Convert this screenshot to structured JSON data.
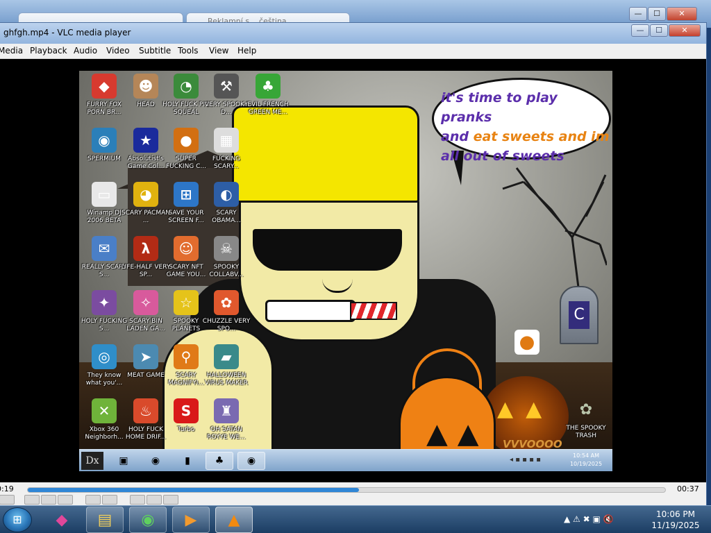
{
  "background_window": {
    "tab1_title": "",
    "tab2_title": "Reklamní s... čeština",
    "caption_min": "—",
    "caption_max": "☐",
    "caption_close": "✕"
  },
  "vlc": {
    "title": "ghfgh.mp4 - VLC media player",
    "window_buttons": {
      "minimize": "—",
      "maximize": "☐",
      "close": "✕"
    },
    "menu": [
      "Media",
      "Playback",
      "Audio",
      "Video",
      "Subtitle",
      "Tools",
      "View",
      "Help"
    ],
    "time_elapsed": "0:19",
    "time_total": "00:37",
    "progress_fraction": 0.52
  },
  "video_frame": {
    "speech_line1": "it's time to play pranks",
    "speech_line2a": "and ",
    "speech_line2b": "eat sweets and im",
    "speech_line3": "all out of sweets",
    "watermark": "VVVOOOO",
    "desktop_icons": [
      {
        "label": "FURRY FOX PORN BR...",
        "icon": "fox-icon",
        "color": "#d73a2f"
      },
      {
        "label": "HEAD",
        "icon": "head-icon",
        "color": "#b58658"
      },
      {
        "label": "HOLY FUCK PIG SQUEAL",
        "icon": "pie-chart-icon",
        "color": "#3b8b3b"
      },
      {
        "label": "VERY SPOOKY D...",
        "icon": "hammer-icon",
        "color": "#555555"
      },
      {
        "label": "EVIL FRENCH GREEN ME...",
        "icon": "messenger-icon",
        "color": "#37a637"
      },
      {
        "label": "SPERMIUM",
        "icon": "browser-icon",
        "color": "#2b7fb9"
      },
      {
        "label": "Absolutist's Game Col...",
        "icon": "star-icon",
        "color": "#1a2a9c"
      },
      {
        "label": "SUPER FUCKING C...",
        "icon": "pumpkin-icon",
        "color": "#d26f12"
      },
      {
        "label": "FUCKING SCARY...",
        "icon": "grid-icon",
        "color": "#dddddd"
      },
      {
        "label": "Winamp DJ 2006 BETA",
        "icon": "window-icon",
        "color": "#e8e8e8"
      },
      {
        "label": "SCARY PACMAN ...",
        "icon": "pacman-icon",
        "color": "#e0b20f"
      },
      {
        "label": "SAVE YOUR SCREEN F...",
        "icon": "windows-logo-icon",
        "color": "#2d76c7"
      },
      {
        "label": "SCARY OBAMA...",
        "icon": "obama-logo-icon",
        "color": "#2d5ea6"
      },
      {
        "label": "REALLY SCARY S...",
        "icon": "xat-icon",
        "color": "#4a7fc7"
      },
      {
        "label": "LIFE-HALF VERY SP...",
        "icon": "half-life-icon",
        "color": "#b22b15"
      },
      {
        "label": "SCARY NFT GAME YOU...",
        "icon": "monkey-icon",
        "color": "#e26c2e"
      },
      {
        "label": "SPOOKY COLLABV...",
        "icon": "skull-icon",
        "color": "#888888"
      },
      {
        "label": "HOLY FUCKING S...",
        "icon": "gift-icon",
        "color": "#7b4ca0"
      },
      {
        "label": "SCARY BIN LADEN GA...",
        "icon": "sparkle-icon",
        "color": "#d85a9c"
      },
      {
        "label": "SPOOKY PLANETS",
        "icon": "star-card-icon",
        "color": "#e5c31a"
      },
      {
        "label": "CHUZZLE VERY SPO...",
        "icon": "chuzzle-icon",
        "color": "#e0582d"
      },
      {
        "label": "They know what you'...",
        "icon": "eyes-icon",
        "color": "#2f8ec9"
      },
      {
        "label": "MEAT GAME",
        "icon": "fish-icon",
        "color": "#4c8ab1"
      },
      {
        "label": "SCARY MAGNIFYI...",
        "icon": "magnifier-icon",
        "color": "#e07a18"
      },
      {
        "label": "HALLOWEEN VIRUS MAKER",
        "icon": "tank-icon",
        "color": "#3a8a8a"
      },
      {
        "label": "Xbox 360 Neighborh...",
        "icon": "xbox-icon",
        "color": "#6fb33a"
      },
      {
        "label": "HOLY FUCK HOME DRIF...",
        "icon": "java-icon",
        "color": "#d94a2b"
      },
      {
        "label": "Turbo",
        "icon": "s-logo-icon",
        "color": "#d91919"
      },
      {
        "label": "OH SATAN ROYYE WE...",
        "icon": "robot-icon",
        "color": "#7a6ab1"
      }
    ],
    "right_pumpkin_icon": "pumpkin-icon",
    "tombstone_letter": "C",
    "trash_label": "THE SPOOKY TRASH",
    "inner_clock_time": "10:54 AM",
    "inner_clock_date": "10/19/2025",
    "inner_start": "Dx"
  },
  "outer_taskbar": {
    "start_icon": "windows-orb-icon",
    "tray_icons": "▲  ⚠  ✖  ▣  🔇",
    "clock_time": "10:06 PM",
    "clock_date": "11/19/2025"
  }
}
